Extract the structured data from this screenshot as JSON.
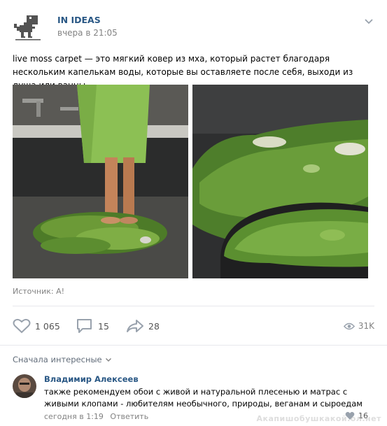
{
  "post": {
    "author": "IN IDEAS",
    "time": "вчера в 21:05",
    "text": "live moss carpet — это мягкий ковер из мха, который растет благодаря нескольким капелькам воды, которые вы оставляете после себя, выходи из душа или ванны.",
    "source": "Источник: A!",
    "likes": "1 065",
    "comments": "15",
    "shares": "28",
    "views": "31K"
  },
  "comments_section": {
    "sort_label": "Сначала интересные",
    "items": [
      {
        "author": "Владимир Алексеев",
        "text": "также рекомендуем обои с живой и натуральной плесенью и матрас с живыми клопами - любителям необычного, природы, веганам и сыроедам",
        "time": "сегодня в 1:19",
        "reply_label": "Ответить",
        "likes": "16"
      }
    ]
  },
  "watermark": "Акапишобушкакой.ол.нет",
  "icons": {
    "avatar": "pixel-dinosaur-icon",
    "more": "chevron-down-icon",
    "like": "heart-icon",
    "comment": "speech-bubble-icon",
    "share": "share-arrow-icon",
    "views": "eye-icon"
  },
  "colors": {
    "link": "#2a5885",
    "muted": "#828282",
    "icon": "#99a2ad",
    "moss": "#5a8a2e",
    "towel": "#8fc55a"
  }
}
